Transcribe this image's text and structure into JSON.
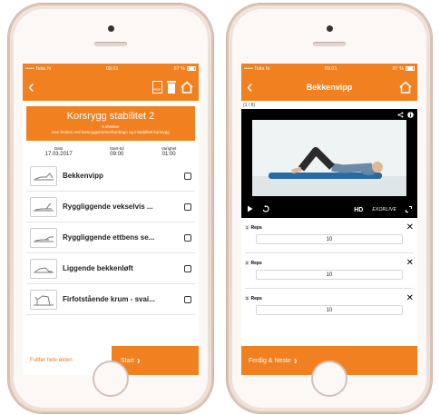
{
  "left_screen": {
    "status": {
      "carrier": "••••• Telia N",
      "time": "09.01",
      "battery": "87 %"
    },
    "nav": {
      "back": "‹",
      "icons": [
        "pdf-icon",
        "trash-icon",
        "home-icon"
      ],
      "pdf_label": "PDF"
    },
    "program": {
      "title": "Korsrygg stabilitet 2",
      "count": "6 Øvelser",
      "description": "Kan brukes ved korsryggsmerter/lumbago og instabilitet korsrygg"
    },
    "meta": [
      {
        "label": "Dato",
        "value": "17.03.2017"
      },
      {
        "label": "Start-tid",
        "value": "09:00"
      },
      {
        "label": "Varighet",
        "value": "01:00"
      }
    ],
    "exercises": [
      {
        "name": "Bekkenvipp"
      },
      {
        "name": "Ryggliggende vekselvis ..."
      },
      {
        "name": "Ryggliggende ettbens se..."
      },
      {
        "name": "Liggende bekkenløft"
      },
      {
        "name": "Firfotstående krum - svai..."
      }
    ],
    "bottom": {
      "finish": "Fullfør hele økten",
      "start": "Start"
    }
  },
  "right_screen": {
    "status": {
      "carrier": "••••• Telia N",
      "time": "09.01",
      "battery": "87 %"
    },
    "nav": {
      "back": "‹",
      "title": "Bekkenvipp",
      "icons": [
        "home-icon"
      ]
    },
    "counter": "(1 / 6)",
    "video": {
      "icons": [
        "share-icon",
        "info-icon",
        "play-icon",
        "replay-icon",
        "fullscreen-icon"
      ],
      "quality": "HD",
      "brand": "EXORLIVE"
    },
    "sets": [
      {
        "num": "1",
        "label": "Reps",
        "value": "10"
      },
      {
        "num": "2",
        "label": "Reps",
        "value": "10"
      },
      {
        "num": "3",
        "label": "Reps",
        "value": "10"
      }
    ],
    "bottom": {
      "next": "Ferdig & Neste"
    }
  },
  "colors": {
    "accent": "#f08020",
    "background": "#ffffff",
    "phone_body": "#efe1d8"
  }
}
